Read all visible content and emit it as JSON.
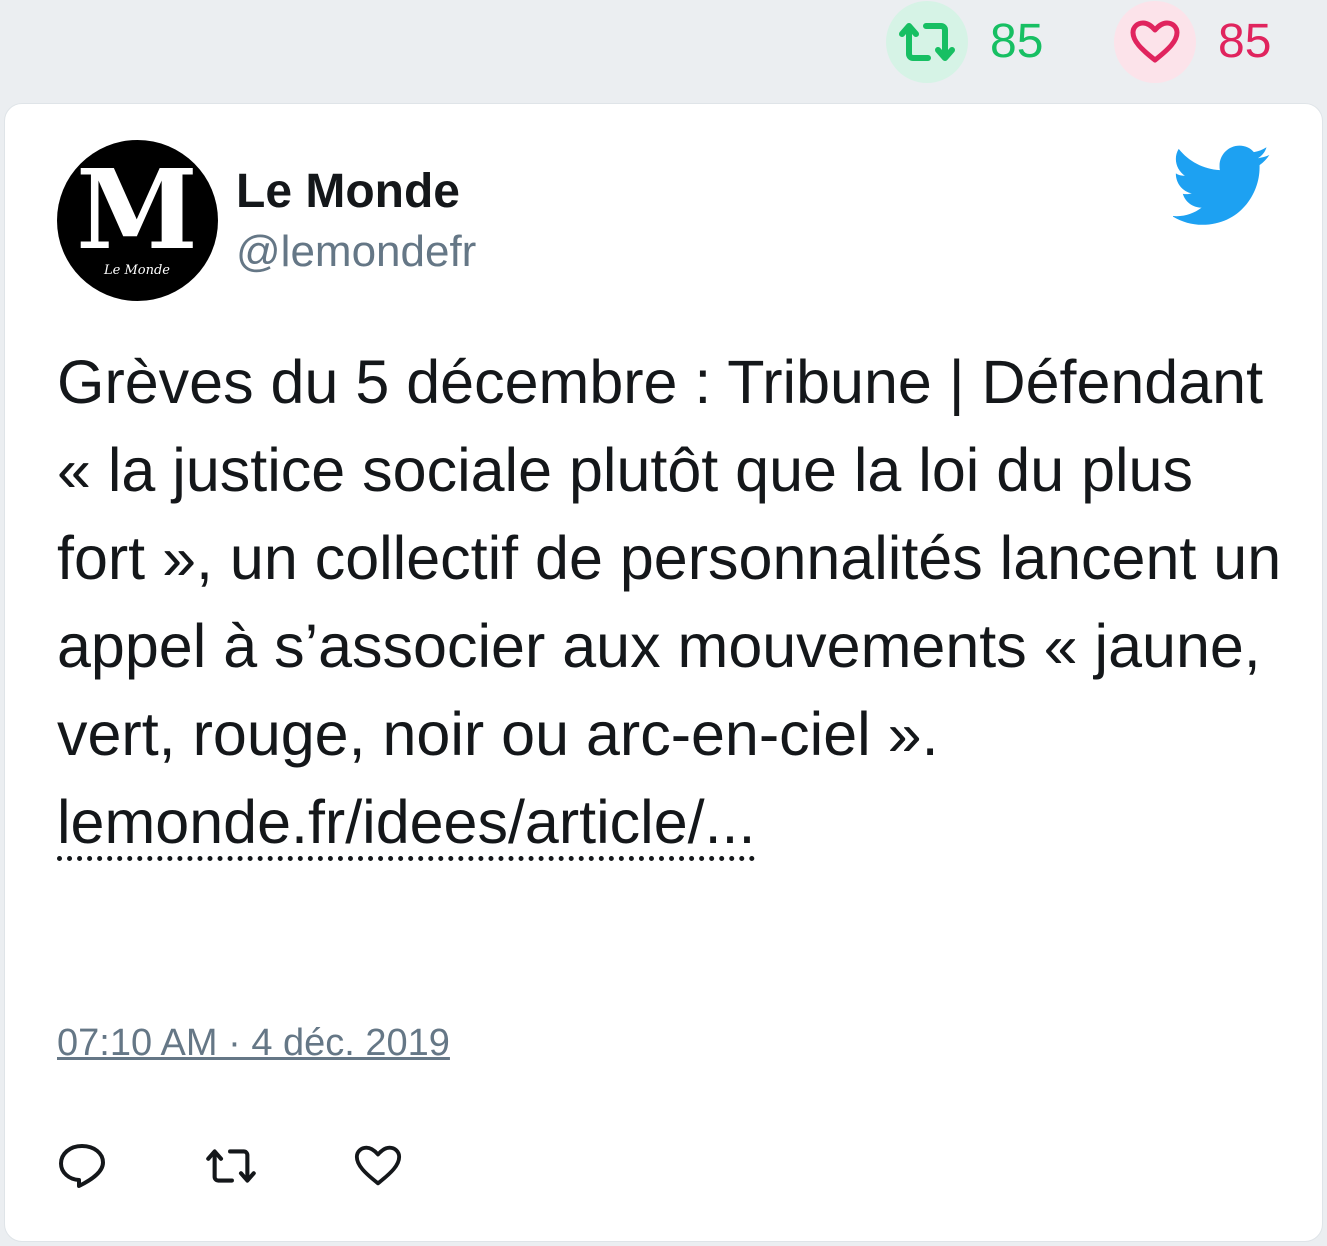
{
  "stats": {
    "retweets": "85",
    "likes": "85"
  },
  "author": {
    "name": "Le Monde",
    "handle": "@lemondefr",
    "avatar_letter": "M",
    "avatar_caption": "Le Monde"
  },
  "tweet": {
    "text": "Grèves du 5 décembre : Tribune | Défendant « la justice sociale plutôt que la loi du plus fort », un collectif de personnalités lancent un appel à s’associer aux mouvements « jaune, vert, rouge, noir ou arc-en-ciel ». ",
    "link_text": "lemonde.fr/idees/article/...",
    "timestamp": "07:10 AM · 4 déc. 2019"
  },
  "icons": {
    "retweet": "retweet-icon",
    "like": "heart-icon",
    "reply": "reply-icon",
    "brand": "twitter-bird-icon"
  },
  "colors": {
    "retweet": "#17bf63",
    "like": "#e0245e",
    "twitter_blue": "#1da1f2",
    "secondary_text": "#657786"
  }
}
